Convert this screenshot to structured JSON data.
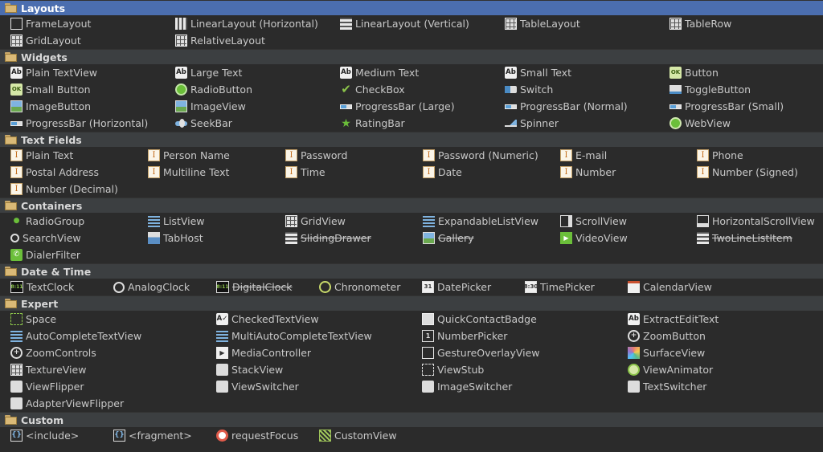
{
  "sections": [
    {
      "title": "Layouts",
      "selected": true,
      "columns": [
        0,
        205,
        410,
        615,
        820
      ],
      "rows": [
        [
          {
            "label": "FrameLayout",
            "icon": "framelayout-icon",
            "cls": "ic-box"
          },
          {
            "label": "LinearLayout (Horizontal)",
            "icon": "linear-horizontal-icon",
            "cls": "ic-vbars"
          },
          {
            "label": "LinearLayout (Vertical)",
            "icon": "linear-vertical-icon",
            "cls": "ic-hbars"
          },
          {
            "label": "TableLayout",
            "icon": "tablelayout-icon",
            "cls": "ic-grid"
          },
          {
            "label": "TableRow",
            "icon": "tablerow-icon",
            "cls": "ic-grid"
          }
        ],
        [
          {
            "label": "GridLayout",
            "icon": "gridlayout-icon",
            "cls": "ic-grid"
          },
          {
            "label": "RelativeLayout",
            "icon": "relativelayout-icon",
            "cls": "ic-grid"
          }
        ]
      ]
    },
    {
      "title": "Widgets",
      "columns": [
        0,
        205,
        410,
        615,
        820
      ],
      "rows": [
        [
          {
            "label": "Plain TextView",
            "icon": "textview-icon",
            "cls": "ic-ab",
            "glyph": "Ab"
          },
          {
            "label": "Large Text",
            "icon": "large-text-icon",
            "cls": "ic-ab",
            "glyph": "Ab"
          },
          {
            "label": "Medium Text",
            "icon": "medium-text-icon",
            "cls": "ic-ab",
            "glyph": "Ab"
          },
          {
            "label": "Small Text",
            "icon": "small-text-icon",
            "cls": "ic-ab",
            "glyph": "Ab"
          },
          {
            "label": "Button",
            "icon": "button-icon",
            "cls": "ic-ok",
            "glyph": "OK"
          }
        ],
        [
          {
            "label": "Small Button",
            "icon": "small-button-icon",
            "cls": "ic-ok",
            "glyph": "OK"
          },
          {
            "label": "RadioButton",
            "icon": "radiobutton-icon",
            "cls": "ic-radio"
          },
          {
            "label": "CheckBox",
            "icon": "checkbox-icon",
            "cls": "ic-check",
            "glyph": "✔"
          },
          {
            "label": "Switch",
            "icon": "switch-icon",
            "cls": "ic-switch"
          },
          {
            "label": "ToggleButton",
            "icon": "togglebutton-icon",
            "cls": "ic-toggle"
          }
        ],
        [
          {
            "label": "ImageButton",
            "icon": "imagebutton-icon",
            "cls": "ic-img"
          },
          {
            "label": "ImageView",
            "icon": "imageview-icon",
            "cls": "ic-img"
          },
          {
            "label": "ProgressBar (Large)",
            "icon": "progressbar-large-icon",
            "cls": "ic-prog"
          },
          {
            "label": "ProgressBar (Normal)",
            "icon": "progressbar-normal-icon",
            "cls": "ic-prog"
          },
          {
            "label": "ProgressBar (Small)",
            "icon": "progressbar-small-icon",
            "cls": "ic-prog"
          }
        ],
        [
          {
            "label": "ProgressBar (Horizontal)",
            "icon": "progressbar-horizontal-icon",
            "cls": "ic-prog"
          },
          {
            "label": "SeekBar",
            "icon": "seekbar-icon",
            "cls": "ic-seek"
          },
          {
            "label": "RatingBar",
            "icon": "ratingbar-icon",
            "cls": "ic-star",
            "glyph": "★"
          },
          {
            "label": "Spinner",
            "icon": "spinner-icon",
            "cls": "ic-spin"
          },
          {
            "label": "WebView",
            "icon": "webview-icon",
            "cls": "ic-web"
          }
        ]
      ]
    },
    {
      "title": "Text Fields",
      "columns": [
        0,
        171,
        342,
        513,
        684,
        854
      ],
      "rows": [
        [
          {
            "label": "Plain Text",
            "icon": "text-field-icon",
            "cls": "ic-text",
            "glyph": "I"
          },
          {
            "label": "Person Name",
            "icon": "text-field-icon",
            "cls": "ic-text",
            "glyph": "I"
          },
          {
            "label": "Password",
            "icon": "text-field-icon",
            "cls": "ic-text",
            "glyph": "I"
          },
          {
            "label": "Password (Numeric)",
            "icon": "text-field-icon",
            "cls": "ic-text",
            "glyph": "I"
          },
          {
            "label": "E-mail",
            "icon": "text-field-icon",
            "cls": "ic-text",
            "glyph": "I"
          },
          {
            "label": "Phone",
            "icon": "text-field-icon",
            "cls": "ic-text",
            "glyph": "I"
          }
        ],
        [
          {
            "label": "Postal Address",
            "icon": "text-field-icon",
            "cls": "ic-text",
            "glyph": "I"
          },
          {
            "label": "Multiline Text",
            "icon": "text-field-icon",
            "cls": "ic-text",
            "glyph": "I"
          },
          {
            "label": "Time",
            "icon": "text-field-icon",
            "cls": "ic-text",
            "glyph": "I"
          },
          {
            "label": "Date",
            "icon": "text-field-icon",
            "cls": "ic-text",
            "glyph": "I"
          },
          {
            "label": "Number",
            "icon": "text-field-icon",
            "cls": "ic-text",
            "glyph": "I"
          },
          {
            "label": "Number (Signed)",
            "icon": "text-field-icon",
            "cls": "ic-text",
            "glyph": "I"
          }
        ],
        [
          {
            "label": "Number (Decimal)",
            "icon": "text-field-icon",
            "cls": "ic-text",
            "glyph": "I"
          }
        ]
      ]
    },
    {
      "title": "Containers",
      "columns": [
        0,
        171,
        342,
        513,
        684,
        854
      ],
      "rows": [
        [
          {
            "label": "RadioGroup",
            "icon": "radiogroup-icon",
            "cls": "ic-rgroup",
            "glyph": "●"
          },
          {
            "label": "ListView",
            "icon": "listview-icon",
            "cls": "ic-list"
          },
          {
            "label": "GridView",
            "icon": "gridview-icon",
            "cls": "ic-grid"
          },
          {
            "label": "ExpandableListView",
            "icon": "expandable-listview-icon",
            "cls": "ic-list"
          },
          {
            "label": "ScrollView",
            "icon": "scrollview-icon",
            "cls": "ic-scroll"
          },
          {
            "label": "HorizontalScrollView",
            "icon": "horizontal-scrollview-icon",
            "cls": "ic-hscroll"
          }
        ],
        [
          {
            "label": "SearchView",
            "icon": "searchview-icon",
            "cls": "ic-search"
          },
          {
            "label": "TabHost",
            "icon": "tabhost-icon",
            "cls": "ic-tab"
          },
          {
            "label": "SlidingDrawer",
            "icon": "slidingdrawer-icon",
            "cls": "ic-hbars",
            "strike": true
          },
          {
            "label": "Gallery",
            "icon": "gallery-icon",
            "cls": "ic-img",
            "strike": true
          },
          {
            "label": "VideoView",
            "icon": "videoview-icon",
            "cls": "ic-video",
            "glyph": "▶"
          },
          {
            "label": "TwoLineListItem",
            "icon": "twolinelistitem-icon",
            "cls": "ic-hbars",
            "strike": true
          }
        ],
        [
          {
            "label": "DialerFilter",
            "icon": "dialerfilter-icon",
            "cls": "ic-dial",
            "glyph": "✆"
          }
        ]
      ]
    },
    {
      "title": "Date & Time",
      "columns": [
        0,
        128,
        256,
        384,
        512,
        640,
        768
      ],
      "rows": [
        [
          {
            "label": "TextClock",
            "icon": "textclock-icon",
            "cls": "ic-digital",
            "glyph": "8:11"
          },
          {
            "label": "AnalogClock",
            "icon": "analogclock-icon",
            "cls": "ic-clock"
          },
          {
            "label": "DigitalClock",
            "icon": "digitalclock-icon",
            "cls": "ic-digital",
            "glyph": "8:11",
            "strike": true
          },
          {
            "label": "Chronometer",
            "icon": "chronometer-icon",
            "cls": "ic-chrono"
          },
          {
            "label": "DatePicker",
            "icon": "datepicker-icon",
            "cls": "ic-date",
            "glyph": "31"
          },
          {
            "label": "TimePicker",
            "icon": "timepicker-icon",
            "cls": "ic-date",
            "glyph": "8:30"
          },
          {
            "label": "CalendarView",
            "icon": "calendarview-icon",
            "cls": "ic-cal"
          }
        ]
      ]
    },
    {
      "title": "Expert",
      "columns": [
        0,
        256,
        512,
        768
      ],
      "rows": [
        [
          {
            "label": "Space",
            "icon": "space-icon",
            "cls": "ic-space"
          },
          {
            "label": "CheckedTextView",
            "icon": "checkedtextview-icon",
            "cls": "ic-ab",
            "glyph": "A✓"
          },
          {
            "label": "QuickContactBadge",
            "icon": "quickcontactbadge-icon",
            "cls": "ic-qc"
          },
          {
            "label": "ExtractEditText",
            "icon": "extractedittext-icon",
            "cls": "ic-ab",
            "glyph": "Ab"
          }
        ],
        [
          {
            "label": "AutoCompleteTextView",
            "icon": "autocomplete-icon",
            "cls": "ic-list"
          },
          {
            "label": "MultiAutoCompleteTextView",
            "icon": "multiautocomplete-icon",
            "cls": "ic-list"
          },
          {
            "label": "NumberPicker",
            "icon": "numberpicker-icon",
            "cls": "ic-np",
            "glyph": "1"
          },
          {
            "label": "ZoomButton",
            "icon": "zoombutton-icon",
            "cls": "ic-zoom",
            "glyph": "+"
          }
        ],
        [
          {
            "label": "ZoomControls",
            "icon": "zoomcontrols-icon",
            "cls": "ic-zoom",
            "glyph": "+"
          },
          {
            "label": "MediaController",
            "icon": "mediacontroller-icon",
            "cls": "ic-media",
            "glyph": "▶"
          },
          {
            "label": "GestureOverlayView",
            "icon": "gestureoverlay-icon",
            "cls": "ic-box"
          },
          {
            "label": "SurfaceView",
            "icon": "surfaceview-icon",
            "cls": "ic-surface"
          }
        ],
        [
          {
            "label": "TextureView",
            "icon": "textureview-icon",
            "cls": "ic-grid"
          },
          {
            "label": "StackView",
            "icon": "stackview-icon",
            "cls": "ic-flip"
          },
          {
            "label": "ViewStub",
            "icon": "viewstub-icon",
            "cls": "ic-stub"
          },
          {
            "label": "ViewAnimator",
            "icon": "viewanimator-icon",
            "cls": "ic-anim"
          }
        ],
        [
          {
            "label": "ViewFlipper",
            "icon": "viewflipper-icon",
            "cls": "ic-flip"
          },
          {
            "label": "ViewSwitcher",
            "icon": "viewswitcher-icon",
            "cls": "ic-flip"
          },
          {
            "label": "ImageSwitcher",
            "icon": "imageswitcher-icon",
            "cls": "ic-flip"
          },
          {
            "label": "TextSwitcher",
            "icon": "textswitcher-icon",
            "cls": "ic-flip"
          }
        ],
        [
          {
            "label": "AdapterViewFlipper",
            "icon": "adapterviewflipper-icon",
            "cls": "ic-flip"
          }
        ]
      ]
    },
    {
      "title": "Custom",
      "columns": [
        0,
        128,
        256,
        384
      ],
      "rows": [
        [
          {
            "label": "<include>",
            "icon": "include-icon",
            "cls": "ic-incl",
            "glyph": "{}"
          },
          {
            "label": "<fragment>",
            "icon": "fragment-icon",
            "cls": "ic-incl",
            "glyph": "{}"
          },
          {
            "label": "requestFocus",
            "icon": "requestfocus-icon",
            "cls": "ic-focus"
          },
          {
            "label": "CustomView",
            "icon": "customview-icon",
            "cls": "ic-custom"
          }
        ]
      ]
    }
  ]
}
